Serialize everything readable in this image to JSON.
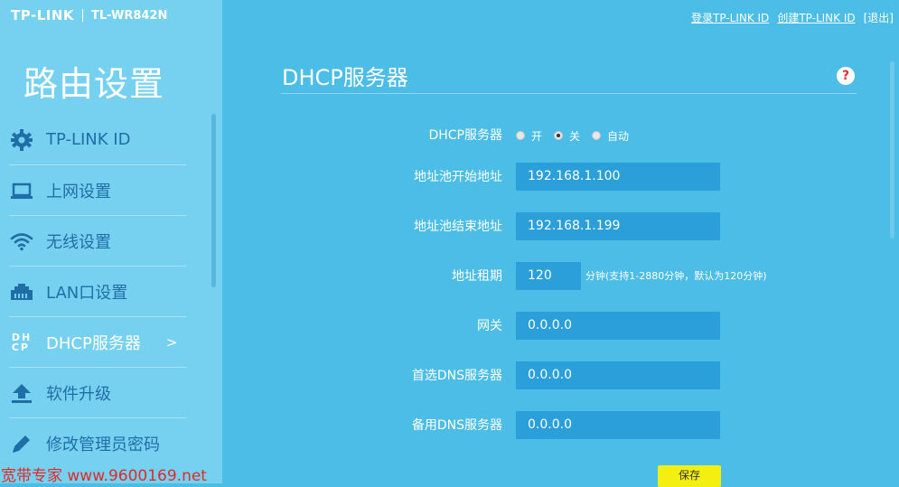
{
  "brand": {
    "logo": "TP-LINK",
    "model": "TL-WR842N"
  },
  "top_links": {
    "login": "登录TP-LINK ID",
    "create": "创建TP-LINK ID",
    "logout": "[退出]"
  },
  "sidebar": {
    "title": "路由设置",
    "items": [
      {
        "label": "TP-LINK ID",
        "icon": "gear-icon"
      },
      {
        "label": "上网设置",
        "icon": "laptop-icon"
      },
      {
        "label": "无线设置",
        "icon": "wifi-icon"
      },
      {
        "label": "LAN口设置",
        "icon": "ethernet-port-icon"
      },
      {
        "label": "DHCP服务器",
        "icon": "dhcp-icon",
        "icon_text_top": "DH",
        "icon_text_bottom": "CP",
        "active": true,
        "chevron": ">"
      },
      {
        "label": "软件升级",
        "icon": "upload-icon"
      },
      {
        "label": "修改管理员密码",
        "icon": "pencil-icon"
      }
    ]
  },
  "main": {
    "title": "DHCP服务器",
    "help": "?",
    "dhcp_label": "DHCP服务器",
    "dhcp_options": [
      {
        "label": "开",
        "selected": false
      },
      {
        "label": "关",
        "selected": true
      },
      {
        "label": "自动",
        "selected": false
      }
    ],
    "pool_start_label": "地址池开始地址",
    "pool_start_value": "192.168.1.100",
    "pool_end_label": "地址池结束地址",
    "pool_end_value": "192.168.1.199",
    "lease_label": "地址租期",
    "lease_value": "120",
    "lease_hint": "分钟(支持1-2880分钟，默认为120分钟)",
    "gateway_label": "网关",
    "gateway_value": "0.0.0.0",
    "dns1_label": "首选DNS服务器",
    "dns1_value": "0.0.0.0",
    "dns2_label": "备用DNS服务器",
    "dns2_value": "0.0.0.0",
    "save_label": "保存"
  },
  "watermark": "宽带专家 www.9600169.net",
  "colors": {
    "main_bg": "#4bbde6",
    "sidebar_bg": "#76d1f1",
    "field_bg": "#2a9fda",
    "nav_text": "#1f6fa6",
    "save_button": "#f3ef11",
    "watermark": "#e12a2a"
  }
}
